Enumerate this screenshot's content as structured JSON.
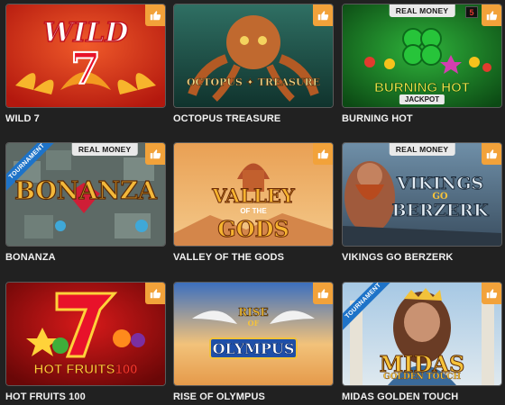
{
  "games": [
    {
      "title": "WILD 7",
      "logo": [
        "WILD",
        "7"
      ],
      "badge": "",
      "ribbon": ""
    },
    {
      "title": "OCTOPUS TREASURE",
      "logo": [
        "OCTOPUS",
        "TREASURE"
      ],
      "badge": "",
      "ribbon": ""
    },
    {
      "title": "BURNING HOT",
      "logo": [
        "BURNING HOT"
      ],
      "badge": "REAL MONEY",
      "ribbon": "",
      "counter": "5",
      "jackpot": "JACKPOT"
    },
    {
      "title": "BONANZA",
      "logo": [
        "BONANZA"
      ],
      "badge": "REAL MONEY",
      "ribbon": "TOURNAMENT"
    },
    {
      "title": "VALLEY OF THE GODS",
      "logo": [
        "VALLEY",
        "OF THE",
        "GODS"
      ],
      "badge": "",
      "ribbon": ""
    },
    {
      "title": "VIKINGS GO BERZERK",
      "logo": [
        "VIKINGS",
        "GO",
        "BERZERK"
      ],
      "badge": "REAL MONEY",
      "ribbon": ""
    },
    {
      "title": "HOT FRUITS 100",
      "logo": [
        "HOT FRUITS",
        "100"
      ],
      "badge": "",
      "ribbon": ""
    },
    {
      "title": "RISE OF OLYMPUS",
      "logo": [
        "RISE",
        "OF",
        "OLYMPUS"
      ],
      "badge": "",
      "ribbon": ""
    },
    {
      "title": "MIDAS GOLDEN TOUCH",
      "logo": [
        "MIDAS",
        "GOLDEN TOUCH"
      ],
      "badge": "",
      "ribbon": "TOURNAMENT"
    }
  ],
  "icons": {
    "like": "thumbs-up-icon"
  },
  "colors": {
    "background": "#212121",
    "like": "#f2a23a",
    "ribbon": "#1e73c8"
  }
}
